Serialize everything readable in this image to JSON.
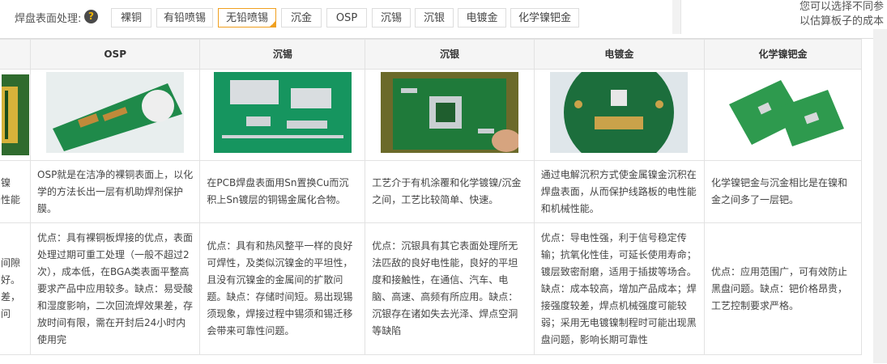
{
  "surface_finish": {
    "label": "焊盘表面处理:",
    "help_glyph": "?",
    "options": [
      "裸铜",
      "有铅喷锡",
      "无铅喷锡",
      "沉金",
      "OSP",
      "沉锡",
      "沉银",
      "电镀金",
      "化学镍钯金"
    ],
    "selected": "无铅喷锡"
  },
  "side_note": {
    "line1": "您可以选择不同参",
    "line2": "以估算板子的成本"
  },
  "table": {
    "columns": [
      "OSP",
      "沉锡",
      "沉银",
      "电镀金",
      "化学镍钯金"
    ],
    "partial_col": {
      "desc": [
        "镍",
        "性能"
      ],
      "pc": [
        "间隙",
        "好。",
        "差，",
        "问"
      ]
    },
    "descriptions": [
      "OSP就是在洁净的裸铜表面上，以化学的方法长出一层有机助焊剂保护膜。",
      "在PCB焊盘表面用Sn置换Cu而沉积上Sn镀层的铜锡金属化合物。",
      "工艺介于有机涂覆和化学镀镍/沉金之间，工艺比较简单、快速。",
      "通过电解沉积方式使金属镍金沉积在焊盘表面，从而保护线路板的电性能和机械性能。",
      "化学镍钯金与沉金相比是在镍和金之间多了一层钯。"
    ],
    "pros_cons": [
      "优点：具有裸铜板焊接的优点，表面处理过期可重工处理（一般不超过2次），成本低，在BGA类表面平整高要求产品中应用较多。缺点：易受酸和湿度影响，二次回流焊效果差，存放时间有限，需在开封后24小时内使用完",
      "优点：具有和热风整平一样的良好可焊性，及类似沉镍金的平坦性，且没有沉镍金的金属间的扩散问题。缺点：存储时间短。易出现锡须现象，焊接过程中锡须和锡迁移会带来可靠性问题。",
      "优点：沉银具有其它表面处理所无法匹敌的良好电性能，良好的平坦度和接触性，在通信、汽车、电脑、高速、高频有所应用。缺点：沉银存在诸如失去光泽、焊点空洞等缺陷",
      "优点：导电性强，利于信号稳定传输；抗氧化性佳，可延长使用寿命；镀层致密耐磨，适用于插拔等场合。缺点：成本较高，增加产品成本；焊接强度较差，焊点机械强度可能较弱；采用无电镀镍制程时可能出现黑盘问题，影响长期可靠性",
      "优点：应用范围广，可有效防止黑盘问题。缺点：钯价格昂贵，工艺控制要求严格。"
    ]
  },
  "colors": {
    "selected_border": "#f0a020",
    "header_bg": "#f5f5f5",
    "border": "#e2e2e2",
    "pcb_green": "#1f8a4a"
  }
}
